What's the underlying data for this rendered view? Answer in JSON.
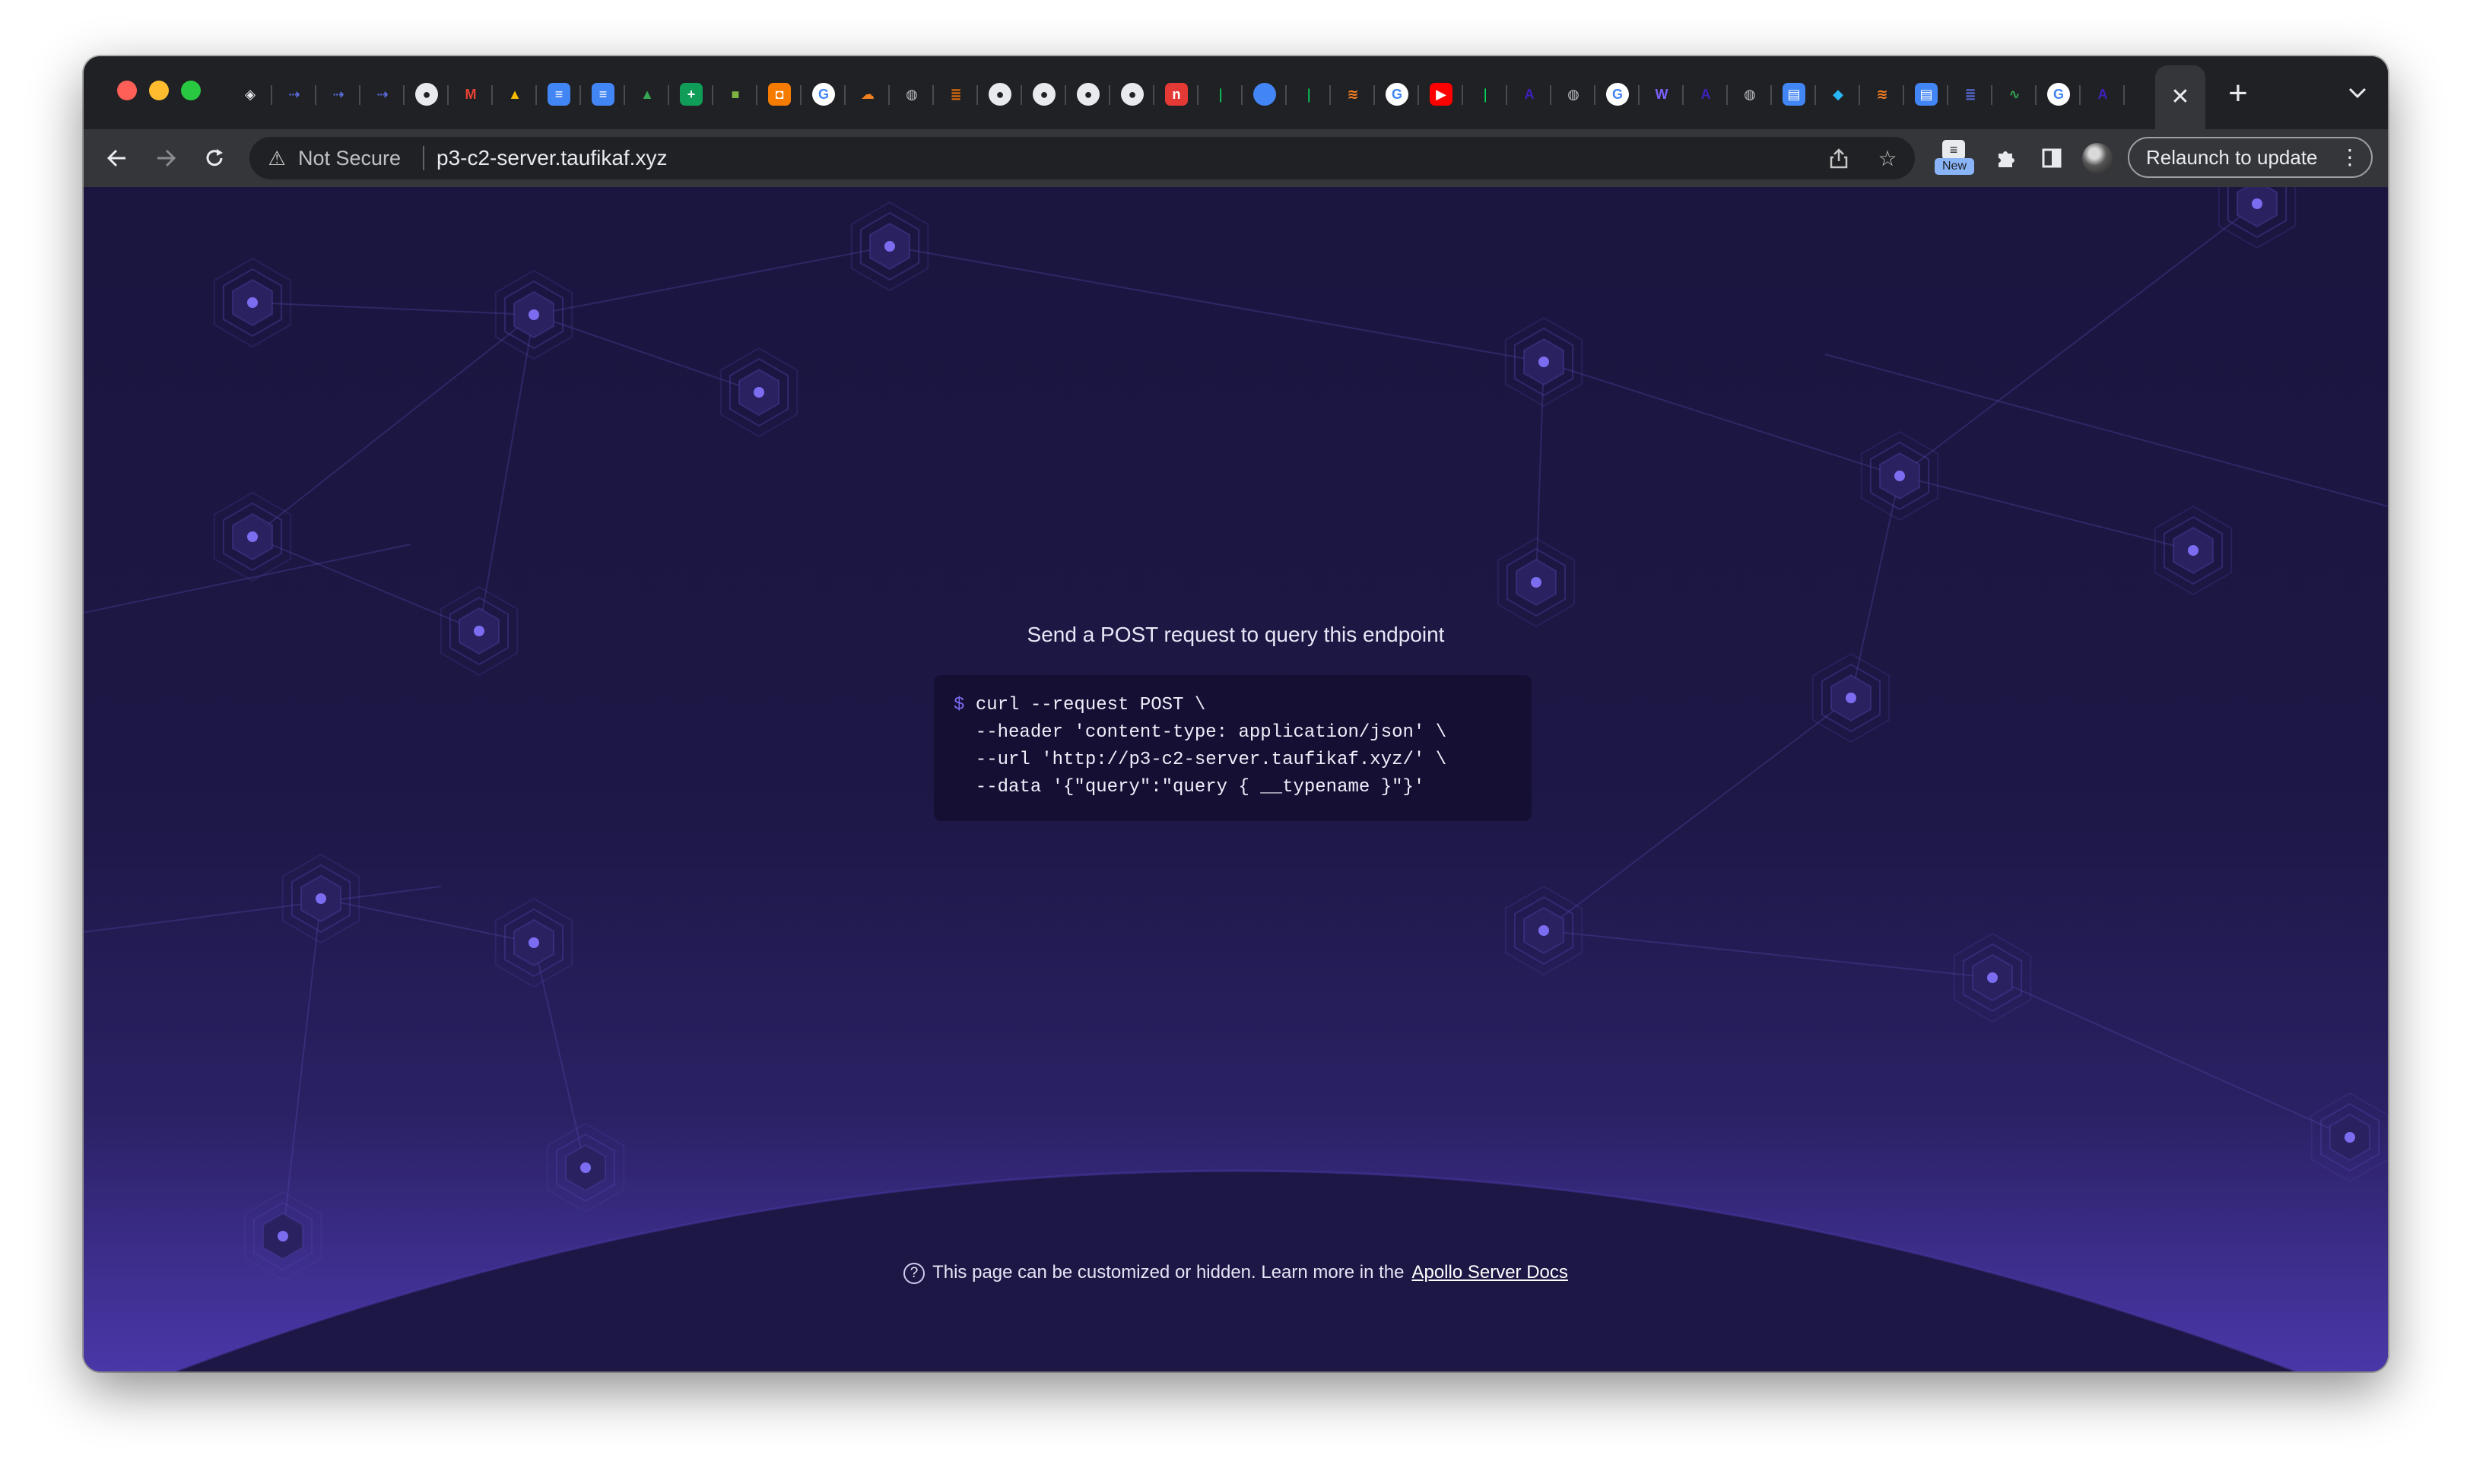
{
  "browser": {
    "tab_favicons": [
      {
        "icon": "bolt-cube-icon",
        "color": "#e8eaed"
      },
      {
        "icon": "arrows-icon",
        "color": "#5b6ee1"
      },
      {
        "icon": "arrows-icon",
        "color": "#5b6ee1"
      },
      {
        "icon": "arrows-icon",
        "color": "#5b6ee1"
      },
      {
        "icon": "github-icon",
        "color": "#e8eaed"
      },
      {
        "icon": "gmail-icon",
        "color": "#ea4335"
      },
      {
        "icon": "google-drive-icon",
        "color": "#fbbc04"
      },
      {
        "icon": "google-docs-icon",
        "color": "#4285f4"
      },
      {
        "icon": "google-docs-icon",
        "color": "#4285f4"
      },
      {
        "icon": "google-drive-icon",
        "color": "#34a853"
      },
      {
        "icon": "google-sheets-icon",
        "color": "#0f9d58"
      },
      {
        "icon": "cube-icon",
        "color": "#7cb342"
      },
      {
        "icon": "box-icon",
        "color": "#f57c00"
      },
      {
        "icon": "google-icon",
        "color": "#ffffff"
      },
      {
        "icon": "cloudflare-icon",
        "color": "#f38020"
      },
      {
        "icon": "globe-icon",
        "color": "#bdc1c6"
      },
      {
        "icon": "list-icon",
        "color": "#e8710a"
      },
      {
        "icon": "github-icon",
        "color": "#e8eaed"
      },
      {
        "icon": "github-icon",
        "color": "#e8eaed"
      },
      {
        "icon": "github-icon",
        "color": "#e8eaed"
      },
      {
        "icon": "github-icon",
        "color": "#e8eaed"
      },
      {
        "icon": "netlify-icon",
        "color": "#e53935"
      },
      {
        "icon": "mongodb-leaf-icon",
        "color": "#00ed64"
      },
      {
        "icon": "blue-circle-icon",
        "color": "#4285f4"
      },
      {
        "icon": "mongodb-leaf-icon",
        "color": "#00ed64"
      },
      {
        "icon": "stackoverflow-icon",
        "color": "#f48024"
      },
      {
        "icon": "google-icon",
        "color": "#ffffff"
      },
      {
        "icon": "youtube-icon",
        "color": "#ff0000"
      },
      {
        "icon": "mongodb-leaf-icon",
        "color": "#00ed64"
      },
      {
        "icon": "apollo-icon",
        "color": "#3f20ba"
      },
      {
        "icon": "globe-icon",
        "color": "#bdc1c6"
      },
      {
        "icon": "google-icon",
        "color": "#ffffff"
      },
      {
        "icon": "webflow-icon",
        "color": "#7b61ff"
      },
      {
        "icon": "apollo-icon",
        "color": "#3f20ba"
      },
      {
        "icon": "globe-icon",
        "color": "#bdc1c6"
      },
      {
        "icon": "layout-icon",
        "color": "#4285f4"
      },
      {
        "icon": "swift-bird-icon",
        "color": "#29b6f6"
      },
      {
        "icon": "stackoverflow-icon",
        "color": "#f48024"
      },
      {
        "icon": "layout-icon",
        "color": "#4285f4"
      },
      {
        "icon": "list-icon",
        "color": "#5b6ee1"
      },
      {
        "icon": "activity-icon",
        "color": "#34a853"
      },
      {
        "icon": "google-icon",
        "color": "#ffffff"
      },
      {
        "icon": "apollo-icon",
        "color": "#3f20ba"
      }
    ],
    "active_tab_close": "✕",
    "new_tab": "+",
    "omnibox": {
      "security_label": "Not Secure",
      "url": "p3-c2-server.taufikaf.xyz"
    },
    "new_badge": "New",
    "relaunch_label": "Relaunch to update"
  },
  "page": {
    "heading": "Send a POST request to query this endpoint",
    "code": {
      "prompt": "$",
      "lines": [
        "curl --request POST \\",
        "  --header 'content-type: application/json' \\",
        "  --url 'http://p3-c2-server.taufikaf.xyz/' \\",
        "  --data '{\"query\":\"query { __typename }\"}'"
      ]
    },
    "footer": {
      "text": "This page can be customized or hidden. Learn more in the",
      "link": "Apollo Server Docs"
    }
  },
  "colors": {
    "accent": "#7b6cf2",
    "page_bg": "#1b1640",
    "code_bg": "#150f33"
  }
}
